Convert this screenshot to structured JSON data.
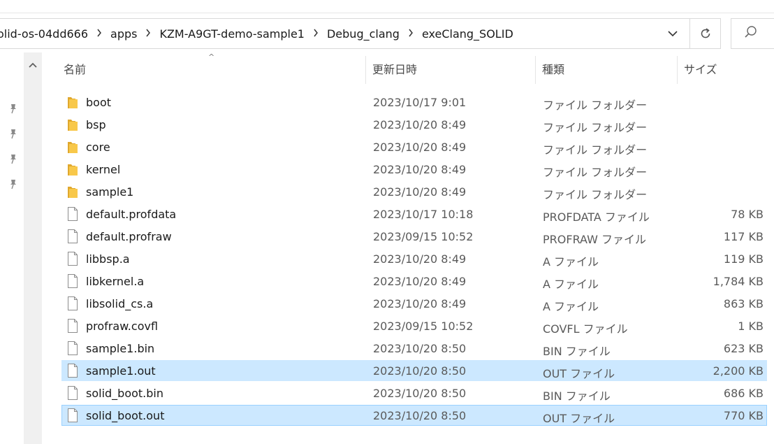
{
  "breadcrumbs": [
    "olid-os-04dd666",
    "apps",
    "KZM-A9GT-demo-sample1",
    "Debug_clang",
    "exeClang_SOLID"
  ],
  "columns": {
    "name": "名前",
    "date": "更新日時",
    "type": "種類",
    "size": "サイズ"
  },
  "files": [
    {
      "name": "boot",
      "date": "2023/10/17 9:01",
      "type": "ファイル フォルダー",
      "size": "",
      "kind": "folder"
    },
    {
      "name": "bsp",
      "date": "2023/10/20 8:49",
      "type": "ファイル フォルダー",
      "size": "",
      "kind": "folder"
    },
    {
      "name": "core",
      "date": "2023/10/20 8:49",
      "type": "ファイル フォルダー",
      "size": "",
      "kind": "folder"
    },
    {
      "name": "kernel",
      "date": "2023/10/20 8:49",
      "type": "ファイル フォルダー",
      "size": "",
      "kind": "folder"
    },
    {
      "name": "sample1",
      "date": "2023/10/20 8:49",
      "type": "ファイル フォルダー",
      "size": "",
      "kind": "folder"
    },
    {
      "name": "default.profdata",
      "date": "2023/10/17 10:18",
      "type": "PROFDATA ファイル",
      "size": "78 KB",
      "kind": "file"
    },
    {
      "name": "default.profraw",
      "date": "2023/09/15 10:52",
      "type": "PROFRAW ファイル",
      "size": "117 KB",
      "kind": "file"
    },
    {
      "name": "libbsp.a",
      "date": "2023/10/20 8:49",
      "type": "A ファイル",
      "size": "119 KB",
      "kind": "file"
    },
    {
      "name": "libkernel.a",
      "date": "2023/10/20 8:49",
      "type": "A ファイル",
      "size": "1,784 KB",
      "kind": "file"
    },
    {
      "name": "libsolid_cs.a",
      "date": "2023/10/20 8:49",
      "type": "A ファイル",
      "size": "863 KB",
      "kind": "file"
    },
    {
      "name": "profraw.covfl",
      "date": "2023/09/15 10:52",
      "type": "COVFL ファイル",
      "size": "1 KB",
      "kind": "file"
    },
    {
      "name": "sample1.bin",
      "date": "2023/10/20 8:50",
      "type": "BIN ファイル",
      "size": "623 KB",
      "kind": "file"
    },
    {
      "name": "sample1.out",
      "date": "2023/10/20 8:50",
      "type": "OUT ファイル",
      "size": "2,200 KB",
      "kind": "file",
      "state": "selected"
    },
    {
      "name": "solid_boot.bin",
      "date": "2023/10/20 8:50",
      "type": "BIN ファイル",
      "size": "686 KB",
      "kind": "file"
    },
    {
      "name": "solid_boot.out",
      "date": "2023/10/20 8:50",
      "type": "OUT ファイル",
      "size": "770 KB",
      "kind": "file",
      "state": "focused"
    }
  ],
  "icons": {
    "folder": "folder-icon",
    "file": "file-icon",
    "pin": "pin-icon",
    "refresh": "refresh-icon",
    "search": "search-icon",
    "dropdown": "chevron-down-icon",
    "separator": "chevron-right-icon"
  },
  "colors": {
    "selection": "#cce8ff",
    "selection_border": "#99d1ff",
    "folder": "#f8c84a",
    "scrollbar": "#f0f0f0"
  }
}
